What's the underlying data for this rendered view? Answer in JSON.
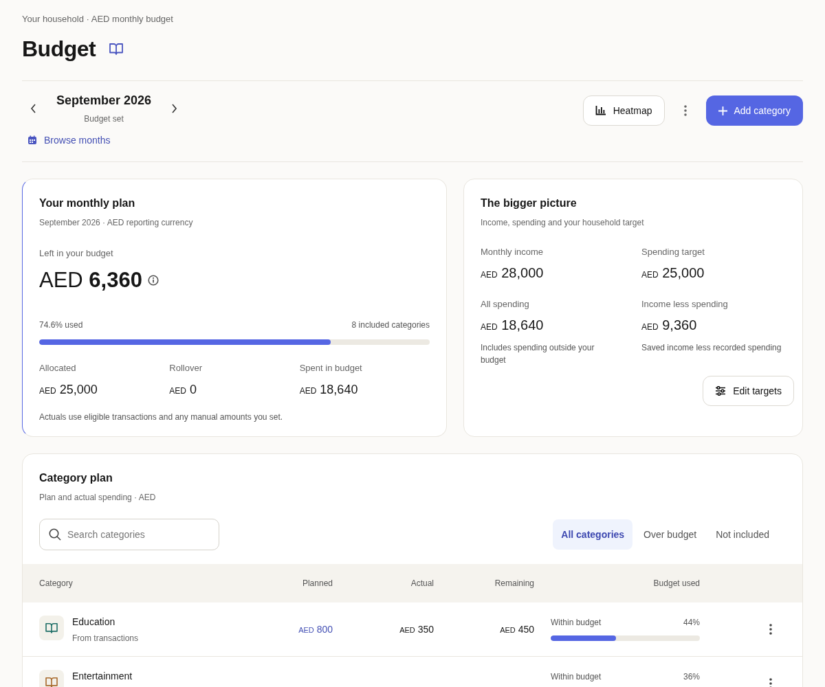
{
  "header": {
    "breadcrumb": "Your household · AED monthly budget",
    "title": "Budget"
  },
  "month_nav": {
    "month": "September 2026",
    "status": "Budget set",
    "browse_link": "Browse months"
  },
  "actions": {
    "heatmap_button": "Heatmap",
    "add_button": "Add category"
  },
  "plan_card": {
    "title": "Your monthly plan",
    "subtitle": "September 2026 · AED reporting currency",
    "left_label": "Left in your budget",
    "left_currency": "AED",
    "left_amount": "6,360",
    "used_text": "74.6% used",
    "included_text": "8 included categories",
    "level": 0.746,
    "stats": [
      {
        "label": "Allocated",
        "currency": "AED",
        "amount": "25,000"
      },
      {
        "label": "Rollover",
        "currency": "AED",
        "amount": "0"
      },
      {
        "label": "Spent in budget",
        "currency": "AED",
        "amount": "18,640"
      }
    ],
    "footnote": "Actuals use eligible transactions and any manual amounts you set."
  },
  "picture_card": {
    "title": "The bigger picture",
    "subtitle": "Income, spending and your household target",
    "stats": [
      {
        "label": "Monthly income",
        "currency": "AED",
        "amount": "28,000"
      },
      {
        "label": "Spending target",
        "currency": "AED",
        "amount": "25,000"
      },
      {
        "label": "All spending",
        "currency": "AED",
        "amount": "18,640",
        "note": "Includes spending outside your budget"
      },
      {
        "label": "Income less spending",
        "currency": "AED",
        "amount": "9,360",
        "note": "Saved income less recorded spending"
      }
    ],
    "edit_button": "Edit targets"
  },
  "category_plan": {
    "title": "Category plan",
    "subtitle": "Plan and actual spending · AED",
    "search": {
      "placeholder": "Search categories"
    },
    "filters": [
      {
        "label": "All categories",
        "selected": true
      },
      {
        "label": "Over budget",
        "selected": false
      },
      {
        "label": "Not included",
        "selected": false
      }
    ],
    "table": {
      "columns": [
        "Category",
        "Planned",
        "Actual",
        "Remaining",
        "Budget used"
      ],
      "rows": [
        {
          "name": "Education",
          "source": "From transactions",
          "color": "#1f6f67",
          "planned": {
            "currency": "AED",
            "amount": "800"
          },
          "actual": {
            "currency": "AED",
            "amount": "350"
          },
          "remaining": {
            "currency": "AED",
            "amount": "450"
          },
          "status": "Within budget",
          "percent": "44%",
          "level": 0.44
        },
        {
          "name": "Entertainment",
          "color": "#a86a2c",
          "status": "Within budget",
          "percent": "36%"
        }
      ]
    }
  }
}
